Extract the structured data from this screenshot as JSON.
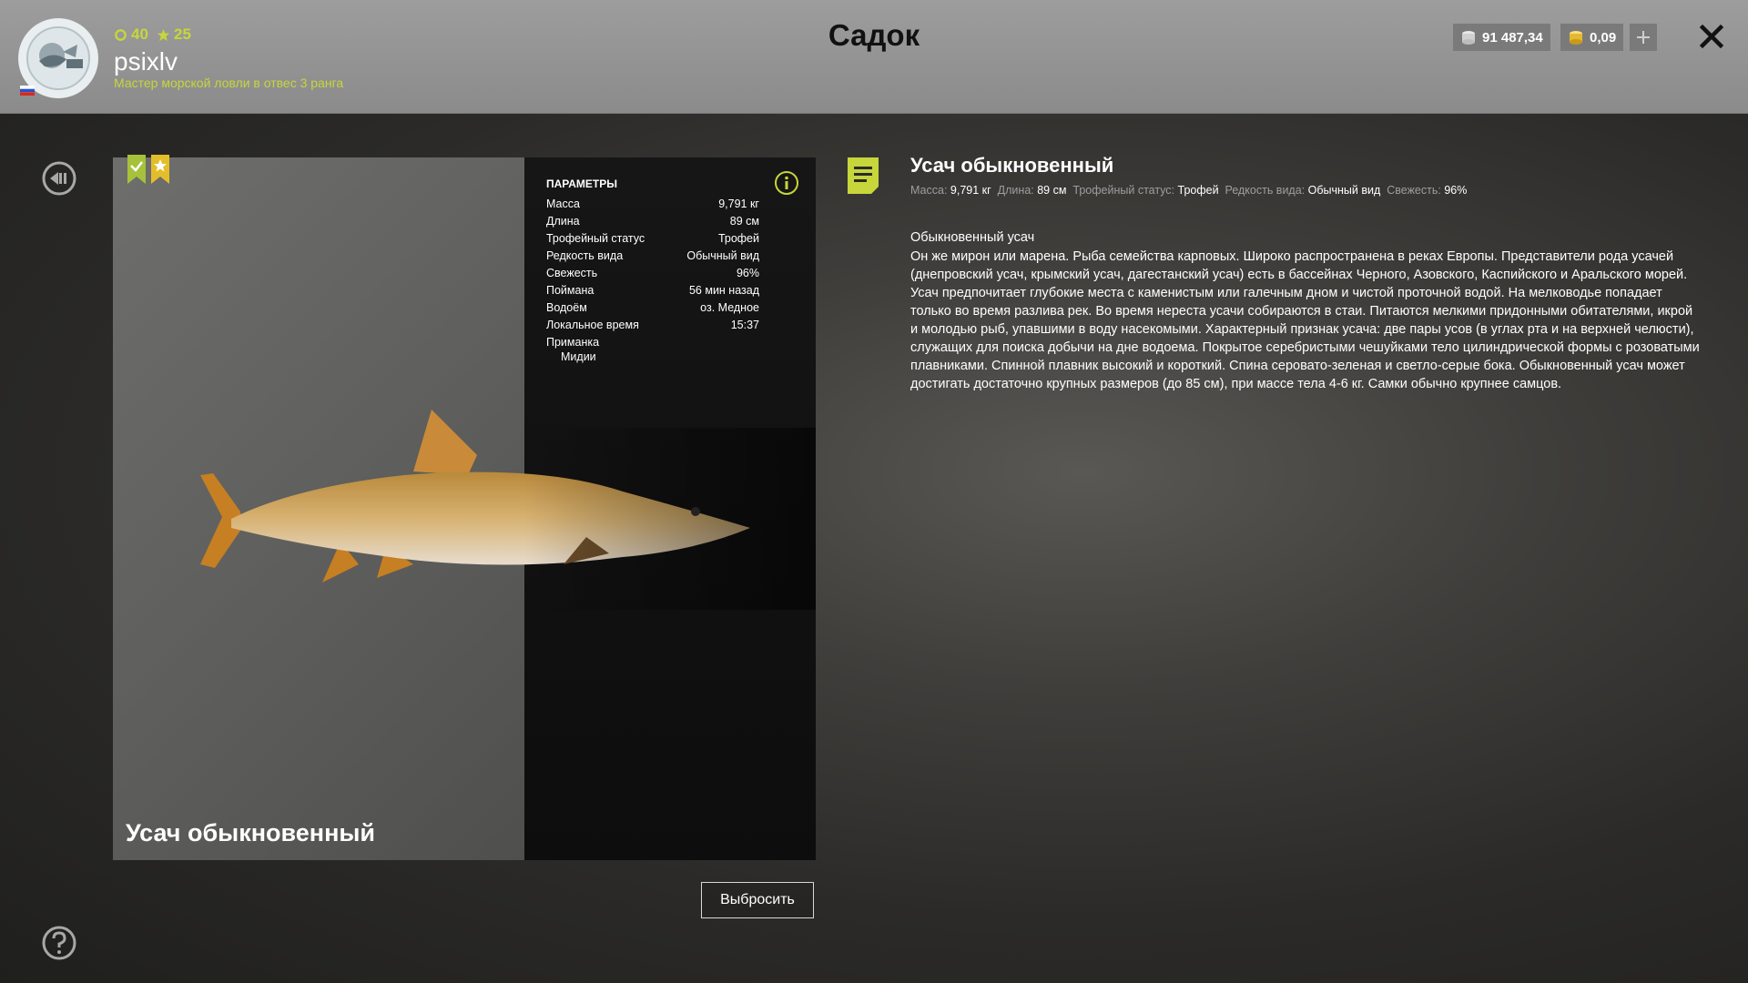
{
  "header": {
    "title": "Садок",
    "player": {
      "username": "psixlv",
      "level": "40",
      "stars": "25",
      "rank": "Мастер морской ловли в отвес 3 ранга"
    },
    "currency": {
      "silver": "91 487,34",
      "gold": "0,09"
    },
    "accent_color": "#c7d63a"
  },
  "fish": {
    "name": "Усач обыкновенный"
  },
  "params": {
    "title": "ПАРАМЕТРЫ",
    "rows": [
      {
        "label": "Масса",
        "value": "9,791 кг"
      },
      {
        "label": "Длина",
        "value": "89 см"
      },
      {
        "label": "Трофейный статус",
        "value": "Трофей"
      },
      {
        "label": "Редкость вида",
        "value": "Обычный вид"
      },
      {
        "label": "Свежесть",
        "value": "96%"
      },
      {
        "label": "Поймана",
        "value": "56 мин назад"
      },
      {
        "label": "Водоём",
        "value": "оз. Медное"
      },
      {
        "label": "Локальное время",
        "value": "15:37"
      }
    ],
    "bait_label": "Приманка",
    "bait_value": "Мидии"
  },
  "actions": {
    "discard_label": "Выбросить"
  },
  "description": {
    "title": "Усач обыкновенный",
    "meta": [
      {
        "label": "Масса:",
        "value": "9,791 кг"
      },
      {
        "label": "Длина:",
        "value": "89 см"
      },
      {
        "label": "Трофейный статус:",
        "value": "Трофей"
      },
      {
        "label": "Редкость вида:",
        "value": "Обычный вид"
      },
      {
        "label": "Свежесть:",
        "value": "96%"
      }
    ],
    "subtitle": "Обыкновенный усач",
    "text": "Он же мирон или марена. Рыба семейства карповых. Широко распространена в реках Европы. Представители рода усачей (днепровский усач, крымский усач, дагестанский усач) есть в бассейнах Черного, Азовского, Каспийского и Аральского морей. Усач предпочитает глубокие места с каменистым или галечным дном и чистой проточной водой. На мелководье попадает только во время разлива рек. Во время нереста усачи собираются в стаи. Питаются мелкими придонными обитателями, икрой и молодью рыб, упавшими в воду насекомыми. Характерный признак усача: две пары усов (в углах рта и на верхней челюсти), служащих для поиска добычи на дне водоема. Покрытое серебристыми чешуйками тело цилиндрической формы с розоватыми плавниками. Спинной плавник высокий и короткий. Спина серовато-зеленая и светло-серые бока. Обыкновенный усач может достигать достаточно крупных размеров (до 85 см), при массе тела 4-6 кг. Самки обычно крупнее самцов."
  }
}
